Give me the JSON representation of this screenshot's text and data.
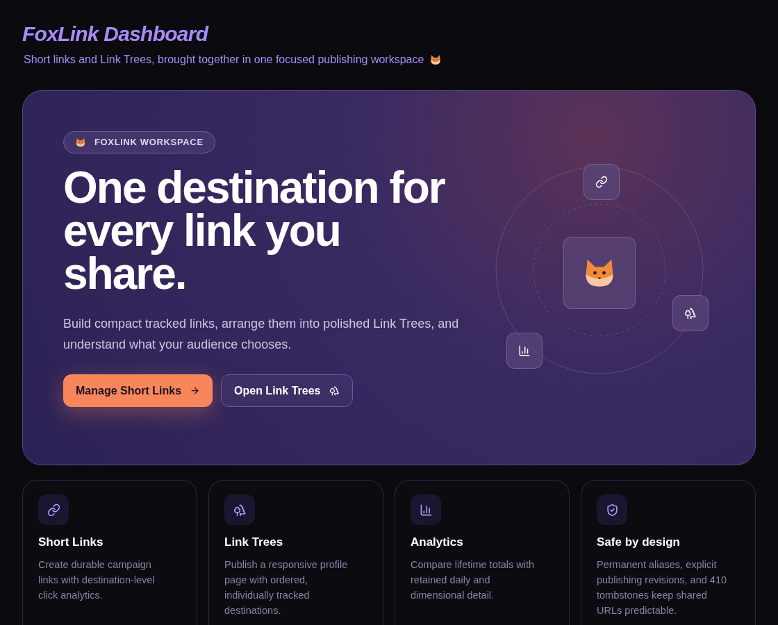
{
  "header": {
    "title": "FoxLink Dashboard",
    "subtitle": "Short links and Link Trees, brought together in one focused publishing workspace"
  },
  "hero": {
    "badge": "FOXLINK WORKSPACE",
    "heading": "One destination for every link you share.",
    "description": "Build compact tracked links, arrange them into polished Link Trees, and understand what your audience chooses.",
    "buttons": [
      {
        "label": "Manage Short Links",
        "kind": "primary"
      },
      {
        "label": "Open Link Trees",
        "kind": "secondary"
      }
    ]
  },
  "features": [
    {
      "kind": "links",
      "title": "Short Links",
      "text": "Create durable campaign links with destination-level click analytics."
    },
    {
      "kind": "trees",
      "title": "Link Trees",
      "text": "Publish a responsive profile page with ordered, individually tracked destinations."
    },
    {
      "kind": "analytics",
      "title": "Analytics",
      "text": "Compare lifetime totals with retained daily and dimensional detail."
    },
    {
      "kind": "safety",
      "title": "Safe by design",
      "text": "Permanent aliases, explicit publishing revisions, and 410 tombstones keep shared URLs predictable."
    }
  ]
}
